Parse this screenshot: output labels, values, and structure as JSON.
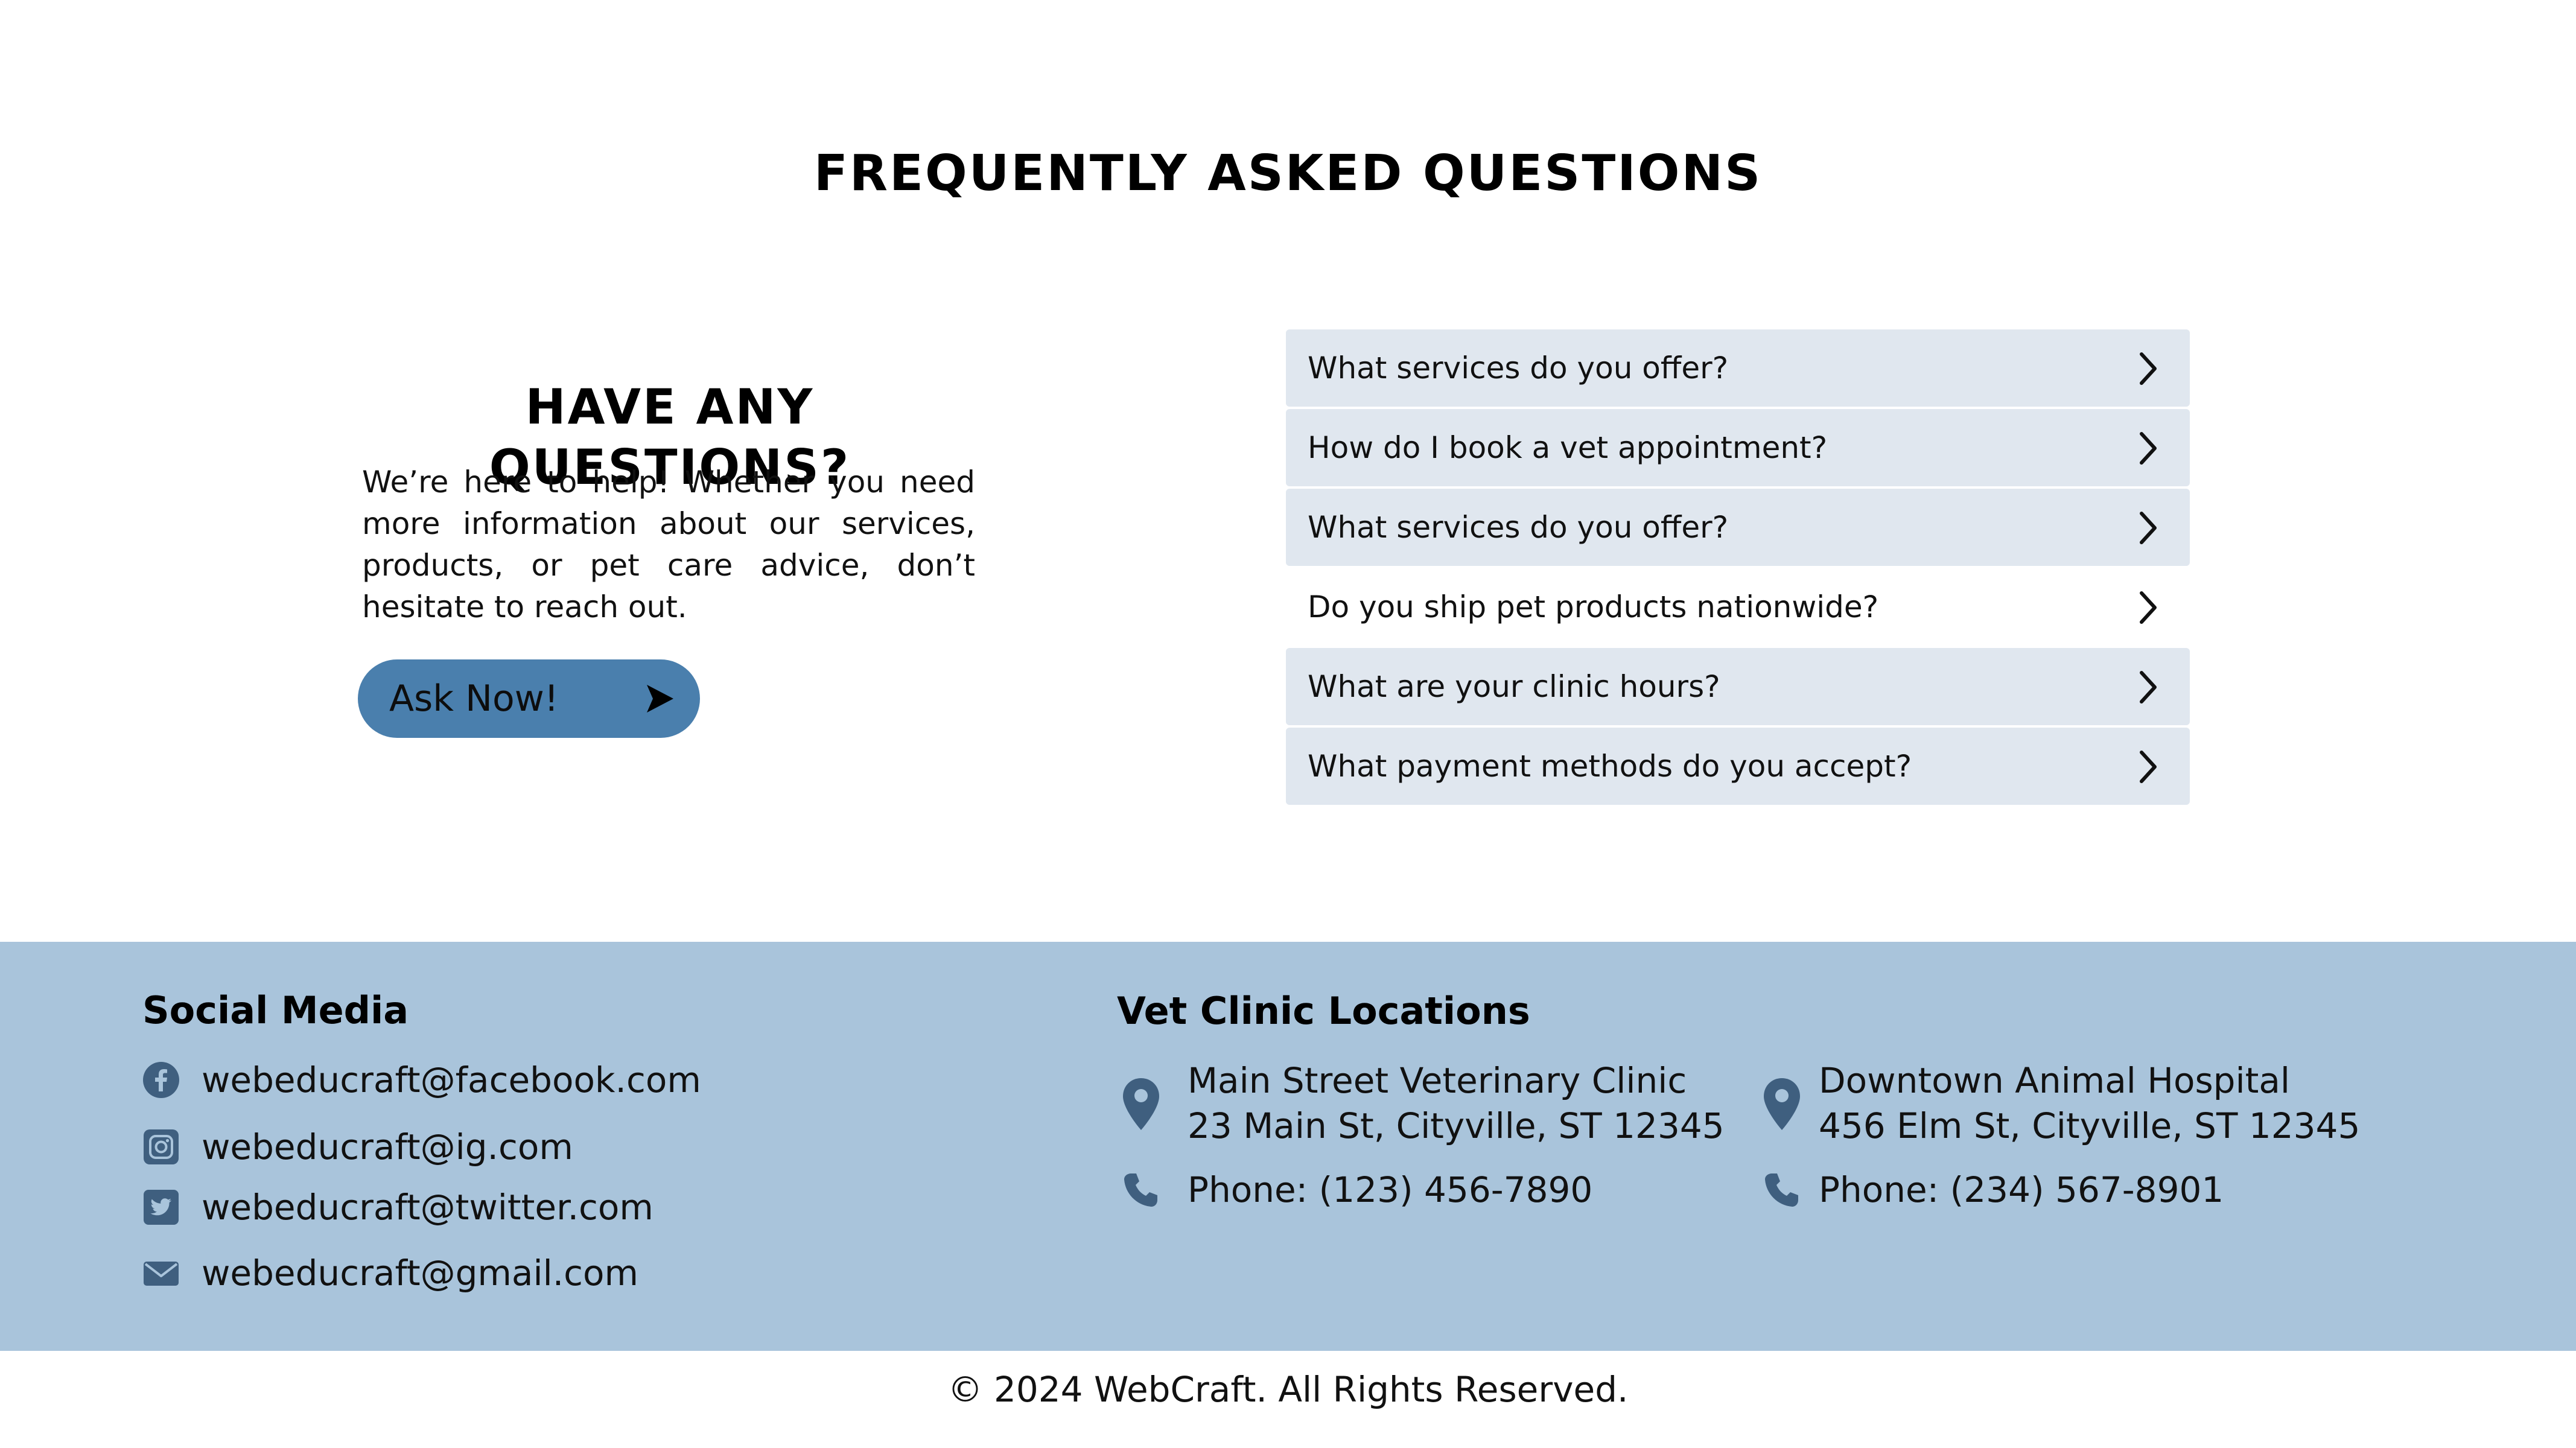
{
  "page": {
    "title": "FREQUENTLY ASKED QUESTIONS"
  },
  "intro": {
    "heading": "HAVE ANY QUESTIONS?",
    "text": "We’re here to help! Whether you need more information about our services, products, or pet care advice, don’t hesitate to reach out.",
    "button_label": "Ask Now!",
    "button_icon": "play-arrow-icon",
    "button_color": "#4a7fad"
  },
  "faq": {
    "items": [
      {
        "question": "What services do you offer?",
        "highlighted": true
      },
      {
        "question": "How do I book a vet appointment?",
        "highlighted": true
      },
      {
        "question": "What services do you offer?",
        "highlighted": true
      },
      {
        "question": "Do you ship pet products nationwide?",
        "highlighted": false
      },
      {
        "question": "What are your clinic hours?",
        "highlighted": true
      },
      {
        "question": "What payment methods do you accept?",
        "highlighted": true
      }
    ],
    "item_color": "#e0e7ef",
    "chevron_icon": "chevron-right-icon"
  },
  "footer": {
    "background": "#a9c4db",
    "social": {
      "heading": "Social Media",
      "items": [
        {
          "icon": "facebook-icon",
          "text": "webeducraft@facebook.com"
        },
        {
          "icon": "instagram-icon",
          "text": "webeducraft@ig.com"
        },
        {
          "icon": "twitter-icon",
          "text": "webeducraft@twitter.com"
        },
        {
          "icon": "email-icon",
          "text": "webeducraft@gmail.com"
        }
      ]
    },
    "locations": {
      "heading": "Vet Clinic Locations",
      "items": [
        {
          "name": "Main Street Veterinary Clinic",
          "address": "23 Main St, Cityville, ST 12345",
          "phone": "Phone: (123) 456-7890"
        },
        {
          "name": "Downtown Animal Hospital",
          "address": "456 Elm St, Cityville, ST 12345",
          "phone": "Phone: (234) 567-8901"
        }
      ],
      "icon_color": "#3f5f7f"
    },
    "copyright": "© 2024 WebCraft. All Rights Reserved."
  }
}
